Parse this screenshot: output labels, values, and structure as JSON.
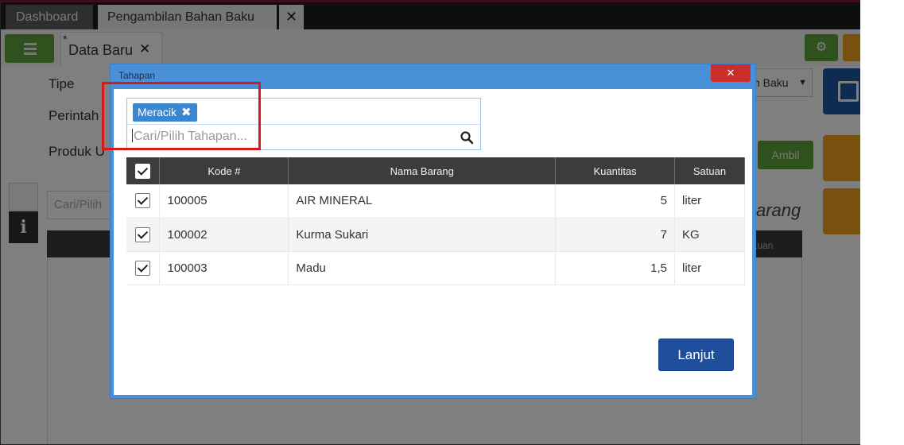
{
  "tabs": {
    "dashboard": "Dashboard",
    "pengambilan": "Pengambilan Bahan Baku",
    "close_symbol": "✕"
  },
  "doc_tab": {
    "star": "*",
    "label": "Data Baru",
    "close_symbol": "✕"
  },
  "form": {
    "tipe_label": "Tipe",
    "perintah_label": "Perintah",
    "produk_label": "Produk U",
    "tipe_value": "n Baku",
    "ambil_label": "Ambil",
    "search_placeholder": "Cari/Pilih",
    "panel_title_partial": "arang",
    "column_partial": "tuan"
  },
  "modal": {
    "title": "Tahapan",
    "close_symbol": "✕",
    "selected_tag": "Meracik",
    "tag_remove_symbol": "✖",
    "search_placeholder": "Cari/Pilih Tahapan...",
    "table": {
      "headers": {
        "kode": "Kode #",
        "nama": "Nama Barang",
        "kuantitas": "Kuantitas",
        "satuan": "Satuan"
      },
      "rows": [
        {
          "kode": "100005",
          "nama": "AIR MINERAL",
          "kuantitas": "5",
          "satuan": "liter",
          "checked": true
        },
        {
          "kode": "100002",
          "nama": "Kurma Sukari",
          "kuantitas": "7",
          "satuan": "KG",
          "checked": true
        },
        {
          "kode": "100003",
          "nama": "Madu",
          "kuantitas": "1,5",
          "satuan": "liter",
          "checked": true
        }
      ]
    },
    "next_button": "Lanjut"
  },
  "icons": {
    "menu": "list-icon",
    "settings": "gear-icon",
    "save": "floppy-disk-icon",
    "print": "printer-icon",
    "attach": "paperclip-icon",
    "search": "magnifier-icon",
    "details": "document-icon",
    "info": "info-icon"
  },
  "colors": {
    "green": "#5ea33a",
    "orange": "#f0a21e",
    "primary_blue": "#1f4e9c",
    "modal_frame": "#4a90d8",
    "close_red": "#c9302c",
    "tag_blue": "#3a87d1",
    "highlight_red": "#d21b1b"
  }
}
